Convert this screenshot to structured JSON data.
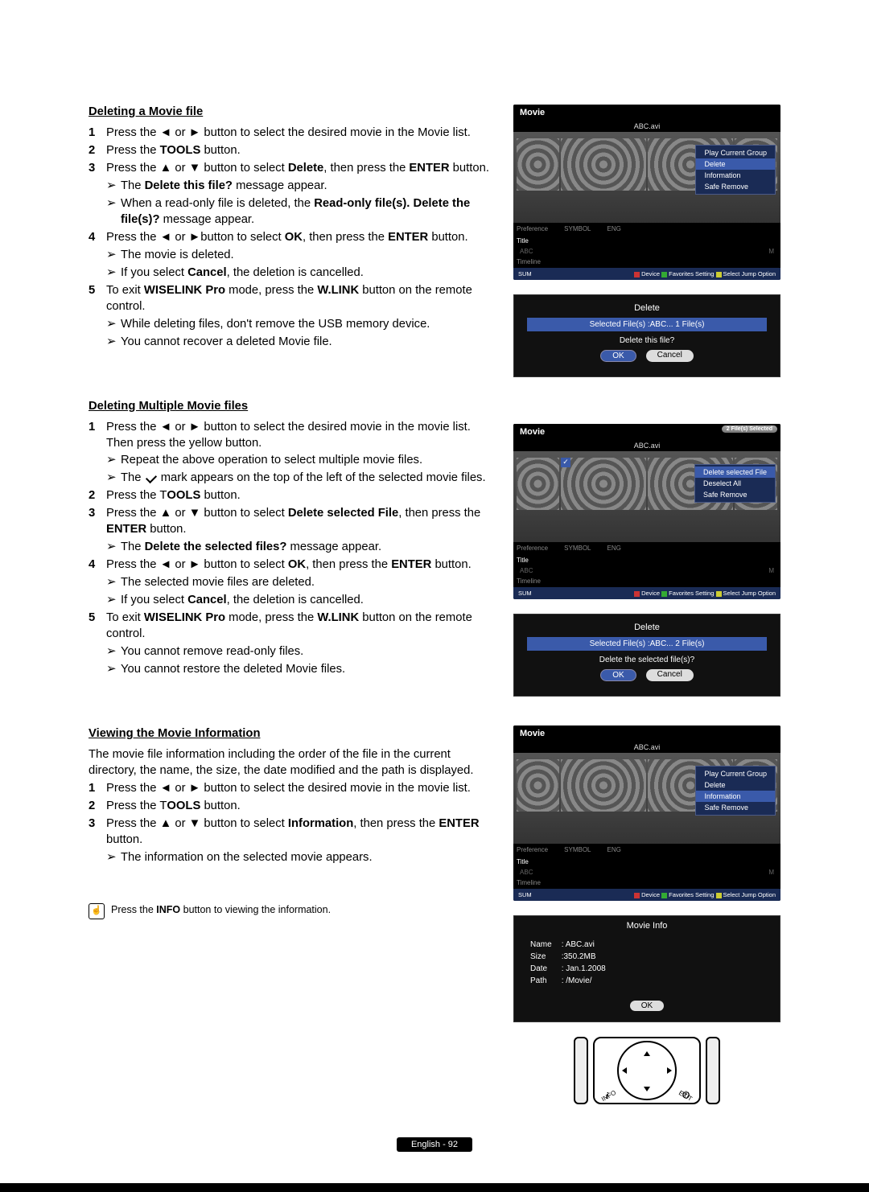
{
  "sec1": {
    "title": "Deleting a Movie file",
    "s1": "Press the ◄ or ► button to select the desired movie in the Movie list.",
    "s2a": "Press the ",
    "s2b": "TOOLS",
    "s2c": " button.",
    "s3a": "Press the ▲ or ▼ button to select ",
    "s3b": "Delete",
    "s3c": ", then press the  ",
    "s3d": "ENTER",
    "s3e": " button.",
    "s3sub1a": "The ",
    "s3sub1b": "Delete this file?",
    "s3sub1c": " message appear.",
    "s3sub2a": "When a read-only file is deleted, the ",
    "s3sub2b": "Read-only file(s). Delete the file(s)?",
    "s3sub2c": " message appear.",
    "s4a": "Press the ◄ or ►button to select ",
    "s4b": "OK",
    "s4c": ", then press the ",
    "s4d": "ENTER",
    "s4e": " button.",
    "s4sub1": "The movie is deleted.",
    "s4sub2a": "If you select ",
    "s4sub2b": "Cancel",
    "s4sub2c": ", the deletion is cancelled.",
    "s5a": "To exit ",
    "s5b": "WISELINK Pro",
    "s5c": " mode, press the ",
    "s5d": "W.LINK",
    "s5e": " button on the remote control.",
    "s5sub1": "While deleting files, don't remove the USB memory device.",
    "s5sub2": "You cannot recover a deleted Movie file."
  },
  "sec2": {
    "title": "Deleting Multiple Movie files",
    "s1": "Press the ◄ or ► button to select the desired movie in the movie list. Then press the yellow button.",
    "s1sub1": "Repeat the above operation to select multiple movie files.",
    "s1sub2a": "The ",
    "s1sub2b": " mark appears on the top of the left of the selected movie files.",
    "s2a": "Press the T",
    "s2b": "OOLS",
    "s2c": " button.",
    "s3a": "Press the ▲ or ▼ button to select ",
    "s3b": "Delete selected File",
    "s3c": ", then press the ",
    "s3d": "ENTER",
    "s3e": "  button.",
    "s3sub1a": "The ",
    "s3sub1b": "Delete the selected files?",
    "s3sub1c": " message appear.",
    "s4a": "Press the ◄ or ► button to select ",
    "s4b": "OK",
    "s4c": ", then press the ",
    "s4d": "ENTER",
    "s4e": " button.",
    "s4sub1": "The selected movie files are deleted.",
    "s4sub2a": "If you select ",
    "s4sub2b": "Cancel",
    "s4sub2c": ", the deletion is cancelled.",
    "s5a": "To exit ",
    "s5b": "WISELINK Pro",
    "s5c": " mode, press the ",
    "s5d": "W.LINK",
    "s5e": " button on the remote control.",
    "s5sub1": "You cannot remove read-only files.",
    "s5sub2": "You cannot restore the deleted Movie files."
  },
  "sec3": {
    "title": "Viewing the Movie Information",
    "intro": "The movie file information including the order of the file in the current directory, the name, the size, the date modified and the path is displayed.",
    "s1": "Press the ◄ or ► button to select the desired movie in the movie list.",
    "s2a": "Press the T",
    "s2b": "OOLS",
    "s2c": " button.",
    "s3a": "Press the ▲ or ▼ button to select ",
    "s3b": "Information",
    "s3c": ", then press the ",
    "s3d": "ENTER",
    "s3e": " button.",
    "s3sub1": "The information on the selected movie appears."
  },
  "shot": {
    "header": "Movie",
    "filename": "ABC.avi",
    "tab_pref": "Preference",
    "tab_title": "Title",
    "tab_timeline": "Timeline",
    "symbol": "SYMBOL",
    "eng": "ENG",
    "sum": "SUM",
    "foot_device": "Device",
    "foot_fav": "Favorites Setting",
    "foot_select": "Select",
    "foot_jump": "Jump",
    "foot_option": "Option",
    "menu1": {
      "play": "Play Current Group",
      "delete": "Delete",
      "info": "Information",
      "safe": "Safe Remove"
    },
    "menu2": {
      "delsel": "Delete selected File",
      "desel": "Deselect All",
      "safe": "Safe Remove"
    },
    "pill": "2 File(s) Selected"
  },
  "dlg1": {
    "title": "Delete",
    "sel": "Selected File(s) :ABC...   1 File(s)",
    "q": "Delete this file?",
    "ok": "OK",
    "cancel": "Cancel"
  },
  "dlg2": {
    "title": "Delete",
    "sel": "Selected File(s) :ABC...   2 File(s)",
    "q": "Delete the selected file(s)?",
    "ok": "OK",
    "cancel": "Cancel"
  },
  "info": {
    "title": "Movie Info",
    "k_name": "Name",
    "v_name": ": ABC.avi",
    "k_size": "Size",
    "v_size": ":350.2MB",
    "k_date": "Date",
    "v_date": ": Jan.1.2008",
    "k_path": "Path",
    "v_path": ": /Movie/",
    "ok": "OK"
  },
  "remote": {
    "info": "INFO",
    "exit": "EXIT"
  },
  "note_a": "Press the ",
  "note_b": "INFO",
  "note_c": " button to viewing the information.",
  "pagenum": "English - 92",
  "letters": {
    "a": "A",
    "b": "B",
    "c": "C",
    "m": "M"
  }
}
